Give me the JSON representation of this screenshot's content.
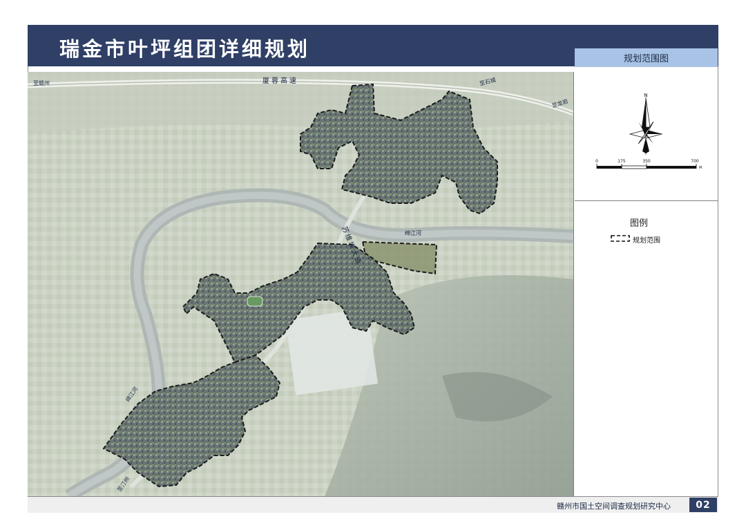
{
  "header": {
    "title": "瑞金市叶坪组团详细规划",
    "tab_label": "规划范围图"
  },
  "map": {
    "labels": {
      "to_ganzhou": "至赣州",
      "expressway": "厦蓉高速",
      "to_shicheng": "至石城",
      "to_longyan": "至龙岩",
      "avenue": "苏维埃大道",
      "river_north": "绵江河",
      "river_south": "绵江河",
      "to_tingzhou": "至汀州"
    }
  },
  "compass": {
    "north": "N",
    "scale_ticks": [
      "0",
      "175",
      "350",
      "700"
    ],
    "unit": "M"
  },
  "legend": {
    "title": "图例",
    "boundary_label": "规划范围"
  },
  "footer": {
    "organization": "赣州市国土空间调查规划研究中心",
    "page": "02"
  },
  "colors": {
    "title_bar": "#2f3f66",
    "tab": "#a9c3e6",
    "boundary": "#1a1a1a"
  }
}
